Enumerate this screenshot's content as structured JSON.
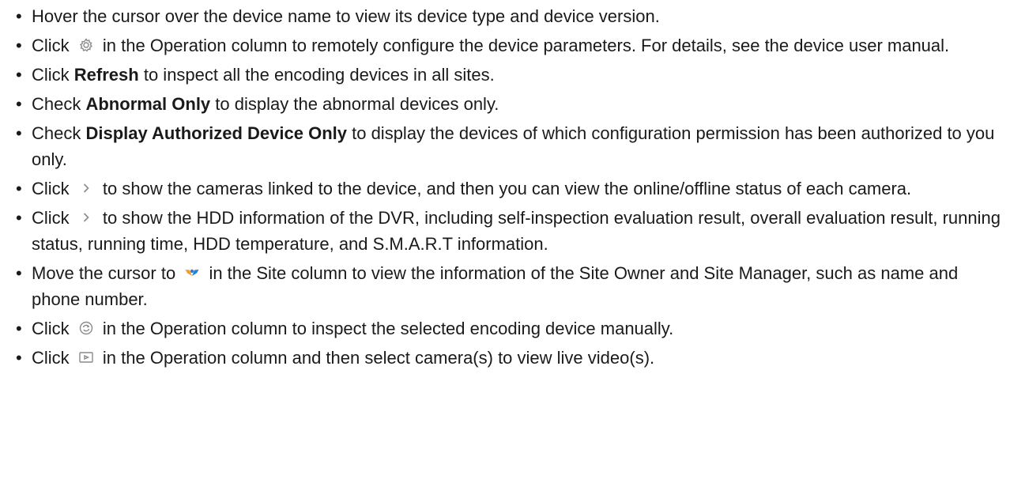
{
  "items": [
    {
      "t1": "Hover the cursor over the device name to view its device type and device version."
    },
    {
      "t1": "Click",
      "icon": "gear-icon",
      "t2": "in the Operation column to remotely configure the device parameters. For details, see the device user manual."
    },
    {
      "t1": "Click",
      "bold": "Refresh",
      "t2": "to inspect all the encoding devices in all sites."
    },
    {
      "t1": "Check",
      "bold": "Abnormal Only",
      "t2": "to display the abnormal devices only."
    },
    {
      "t1": "Check",
      "bold": "Display Authorized Device Only",
      "t2": "to display the devices of which configuration permission has been authorized to you only."
    },
    {
      "t1": "Click",
      "icon": "chevron-right-icon",
      "t2": "to show the cameras linked to the device, and then you can view the online/offline status of each camera."
    },
    {
      "t1": "Click",
      "icon": "chevron-right-icon",
      "t2": "to show the HDD information of the DVR, including self-inspection evaluation result, overall evaluation result, running status, running time, HDD temperature, and S.M.A.R.T information."
    },
    {
      "t1": "Move the cursor to",
      "icon": "site-owner-icon",
      "t2": "in the Site column to view the information of the Site Owner and Site Manager, such as name and phone number."
    },
    {
      "t1": "Click",
      "icon": "manual-inspect-icon",
      "t2": "in the Operation column to inspect the selected encoding device manually."
    },
    {
      "t1": "Click",
      "icon": "live-view-icon",
      "t2": "in the Operation column and then select camera(s) to view live video(s)."
    }
  ],
  "colors": {
    "text": "#1a1a1a",
    "icon_gray": "#8a8a8a",
    "site_icon_blue": "#2f7fd6",
    "site_icon_orange": "#f0a030"
  }
}
